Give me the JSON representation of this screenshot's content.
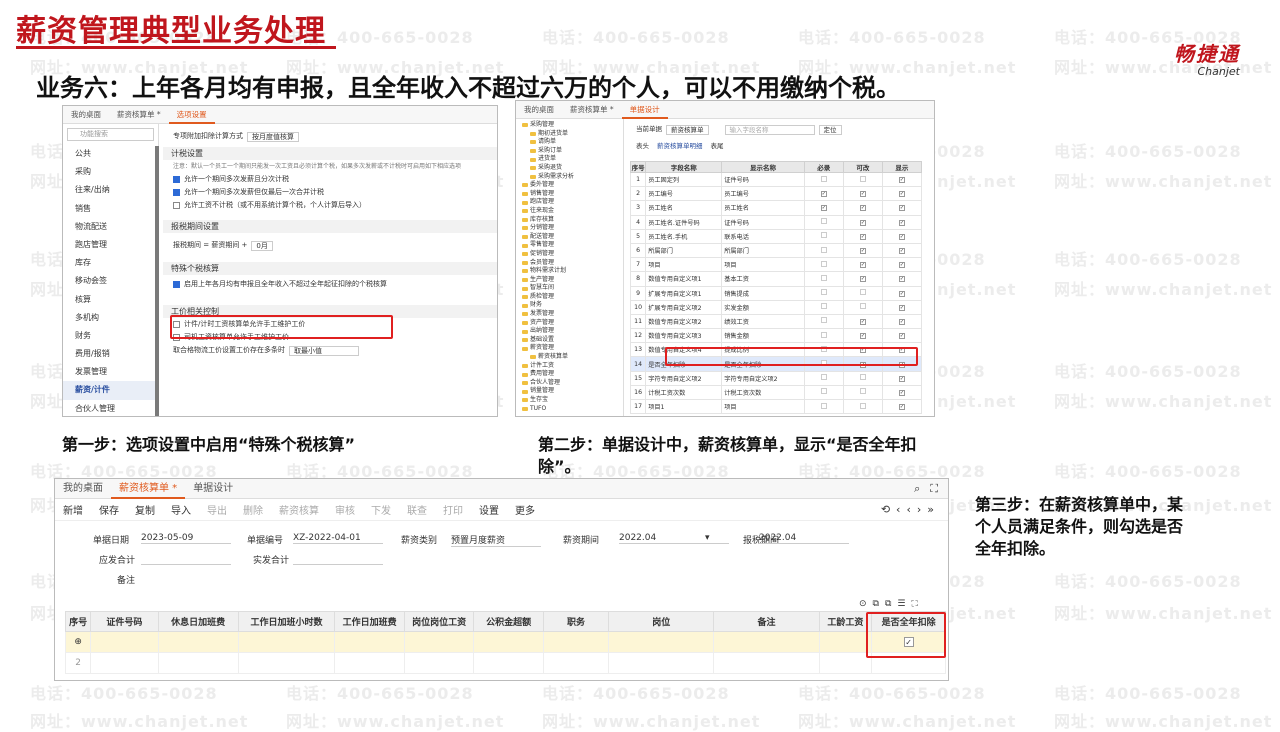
{
  "watermark": {
    "phone": "电话：400-665-0028",
    "site": "网址：www.chanjet.net"
  },
  "header": {
    "title": "薪资管理典型业务处理",
    "logo_cn": "畅捷通",
    "logo_en": "Chanjet",
    "subtitle": "业务六：上年各月均有申报，且全年收入不超过六万的个人，可以不用缴纳个税。"
  },
  "shot1": {
    "tabs": [
      "我的桌面",
      "薪资核算单 *",
      "选项设置"
    ],
    "search_placeholder": "功能搜索",
    "sidebar": [
      "公共",
      "采购",
      "往来/出纳",
      "销售",
      "物流配送",
      "跑店管理",
      "库存",
      "移动会签",
      "核算",
      "多机构",
      "财务",
      "费用/报销",
      "发票管理",
      "薪资/计件",
      "合伙人管理"
    ],
    "active_item": "薪资/计件",
    "top_label": "专项附加扣除计算方式",
    "top_value": "按月度值核算",
    "sec_tax": "计税设置",
    "note": "注意：默认一个员工一个期间只能发一次工资且必须计算个税，如果多次发薪或不计税时可启用如下相应选项",
    "opt1": "允许一个期间多次发薪且分次计税",
    "opt2": "允许一个期间多次发薪但仅最后一次合并计税",
    "opt3": "允许工资不计税（或不用系统计算个税，个人计算后导入）",
    "sec_period": "报税期间设置",
    "period_label": "报税期间 = 薪资期间 +",
    "period_value": "0月",
    "sec_special": "特殊个税核算",
    "special_opt": "启用上年各月均有申报且全年收入不超过全年起征扣除的个税核算",
    "sec_wage": "工价相关控制",
    "wage1": "计件/计时工资核算单允许手工维护工价",
    "wage2": "司机工资核算单允许手工维护工价",
    "wage3_label": "取合格物流工价设置工价存在多条时",
    "wage3_value": "取最小值"
  },
  "shot2": {
    "tabs": [
      "我的桌面",
      "薪资核算单 *",
      "单据设计"
    ],
    "doc_label": "当前单据",
    "doc_value": "薪资核算单",
    "search_placeholder": "输入字段名称",
    "locate": "定位",
    "subtabs": [
      "表头",
      "薪资核算单明细",
      "表尾"
    ],
    "tree": [
      "采购管理",
      "期初进货单",
      "请购单",
      "采购订单",
      "进货单",
      "采购退货",
      "采购需求分析",
      "委外管理",
      "销售管理",
      "跑店管理",
      "往来现金",
      "库存核算",
      "分销管理",
      "配送管理",
      "零售管理",
      "促销管理",
      "会员管理",
      "物料需求计划",
      "生产管理",
      "智慧车间",
      "质检管理",
      "财务",
      "发票管理",
      "资产管理",
      "出纳管理",
      "基础设置",
      "薪资管理",
      "薪资核算单",
      "计件工资",
      "费用管理",
      "合伙人管理",
      "销量管理",
      "生存宝",
      "TUFO"
    ],
    "headers": [
      "序号",
      "字段名称",
      "显示名称",
      "必录",
      "可改",
      "显示"
    ],
    "rows": [
      [
        "1",
        "员工固定列",
        "证件号码"
      ],
      [
        "2",
        "员工编号",
        "员工编号"
      ],
      [
        "3",
        "员工姓名",
        "员工姓名"
      ],
      [
        "4",
        "员工姓名.证件号码",
        "证件号码"
      ],
      [
        "5",
        "员工姓名.手机",
        "联系电话"
      ],
      [
        "6",
        "所属部门",
        "所属部门"
      ],
      [
        "7",
        "项目",
        "项目"
      ],
      [
        "8",
        "数值专用自定义项1",
        "基本工资"
      ],
      [
        "9",
        "扩展专用自定义项1",
        "销售提成"
      ],
      [
        "10",
        "扩展专用自定义项2",
        "实发金额"
      ],
      [
        "11",
        "数值专用自定义项2",
        "绩效工资"
      ],
      [
        "12",
        "数值专用自定义项3",
        "销售金额"
      ],
      [
        "13",
        "数值专用自定义项4",
        "提成比例"
      ],
      [
        "14",
        "是否全年扣除",
        "是否全年扣除"
      ],
      [
        "15",
        "字符专用自定义项2",
        "字符专用自定义项2"
      ],
      [
        "16",
        "计税工资次数",
        "计税工资次数"
      ],
      [
        "17",
        "项目1",
        "项目"
      ]
    ],
    "highlight_row": "是否全年扣除"
  },
  "captions": {
    "step1": "第一步：选项设置中启用“特殊个税核算”",
    "step2": "第二步：单据设计中，薪资核算单，显示“是否全年扣除”。",
    "step3": "第三步：在薪资核算单中，某个人员满足条件，则勾选是否全年扣除。"
  },
  "shot3": {
    "tabs": [
      "我的桌面",
      "薪资核算单 *",
      "单据设计"
    ],
    "toolbar": [
      "新增",
      "保存",
      "复制",
      "导入",
      "导出",
      "删除",
      "薪资核算",
      "审核",
      "下发",
      "联查",
      "打印",
      "设置",
      "更多"
    ],
    "form": {
      "date_label": "单据日期",
      "date_value": "2023-05-09",
      "no_label": "单据编号",
      "no_value": "XZ-2022-04-01",
      "type_label": "薪资类别",
      "type_value": "预置月度薪资",
      "period_label": "薪资期间",
      "period_value": "2022.04",
      "tax_period_label": "报税期间",
      "tax_period_value": "2022.04",
      "due_label": "应发合计",
      "paid_label": "实发合计",
      "remark_label": "备注"
    },
    "columns": [
      "序号",
      "证件号码",
      "休息日加班费",
      "工作日加班小时数",
      "工作日加班费",
      "岗位岗位工资",
      "公积金超额",
      "职务",
      "岗位",
      "备注",
      "工龄工资",
      "是否全年扣除"
    ],
    "row_numbers": [
      "1",
      "2"
    ]
  }
}
